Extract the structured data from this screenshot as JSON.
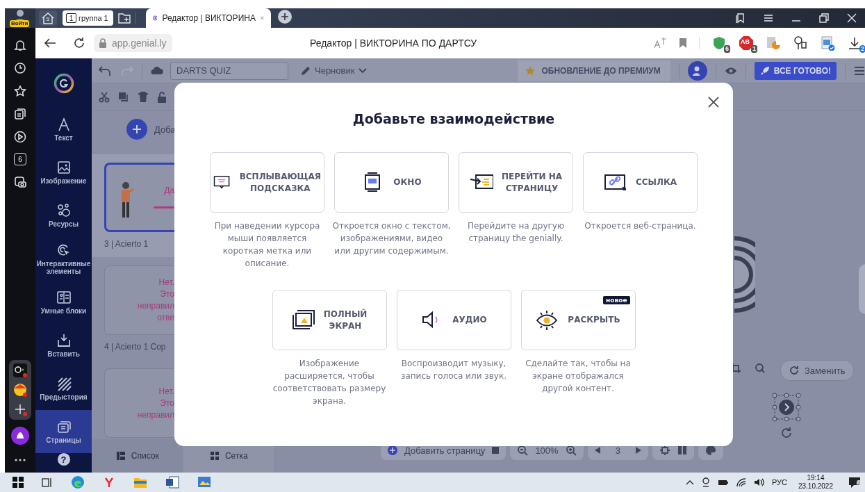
{
  "browser": {
    "profile_label": "Войти",
    "home_count": "5",
    "tab_group": {
      "number": "1",
      "name": "группа 1"
    },
    "tabs": [
      {
        "title": "Редактор | ВИКТОРИНА",
        "selected": true
      }
    ],
    "url": "app.genial.ly",
    "page_title": "Редактор | ВИКТОРИНА ПО ДАРТСУ",
    "extensions": [
      {
        "kind": "shield",
        "badge": "6"
      },
      {
        "kind": "adblock",
        "label": "AB",
        "badge": "1"
      },
      {
        "kind": "pacman"
      },
      {
        "kind": "keys"
      },
      {
        "kind": "image"
      },
      {
        "kind": "download",
        "badge": "2"
      }
    ]
  },
  "side_panel": {
    "calendar_day": "6"
  },
  "app_sidebar": {
    "items": [
      {
        "kind": "text",
        "label": "Текст",
        "selected": false
      },
      {
        "kind": "image",
        "label": "Изображение",
        "selected": false
      },
      {
        "kind": "resources",
        "label": "Ресурсы",
        "selected": false
      },
      {
        "kind": "interactive",
        "label": "Интерактивные элементы",
        "selected": false
      },
      {
        "kind": "smart",
        "label": "Умные блоки",
        "selected": false
      },
      {
        "kind": "insert",
        "label": "Вставить",
        "selected": false
      },
      {
        "kind": "background",
        "label": "Предыстория",
        "selected": false
      },
      {
        "kind": "pages",
        "label": "Страницы",
        "selected": true
      }
    ],
    "help": "?"
  },
  "toolbar": {
    "title_field": "DARTS QUIZ",
    "status": "Черновик",
    "upgrade": "ОБНОВЛЕНИЕ ДО ПРЕМИУМ",
    "publish": "ВСЕ ГОТОВО!"
  },
  "pages_panel": {
    "add_label": "Доба",
    "pages": [
      {
        "selected": true,
        "thumbnail_lines": [
          "Да"
        ],
        "caption": "3 | Acierto 1"
      },
      {
        "selected": false,
        "thumbnail_lines": [
          "Нет.",
          "Это",
          "неправил",
          "отве"
        ],
        "caption": "4 | Acierto 1 Cop"
      },
      {
        "selected": false,
        "thumbnail_lines": [
          "Нет.",
          "Это",
          "неправил"
        ]
      }
    ],
    "view_tabs": [
      {
        "label": "Список",
        "selected": true
      },
      {
        "label": "Сетка",
        "selected": false
      }
    ]
  },
  "canvas": {
    "replace_button": "Заменить"
  },
  "bottom_bar": {
    "add_page": "Добавить страницу",
    "zoom": "100%",
    "page": "3"
  },
  "modal": {
    "title": "Добавьте взаимодействие",
    "option_rows": [
      [
        {
          "kind": "tooltip",
          "label": "ВСПЛЫВАЮЩАЯ\nПОДСКАЗКА",
          "description": "При наведении курсора мыши появляется короткая метка или описание."
        },
        {
          "kind": "window",
          "label": "ОКНО",
          "description": "Откроется окно с текстом, изображениями, видео или другим содержимым."
        },
        {
          "kind": "goto",
          "label": "ПЕРЕЙТИ НА\nСТРАНИЦУ",
          "description": "Перейдите на другую страницу the genially."
        },
        {
          "kind": "link",
          "label": "ССЫЛКА",
          "description": "Откроется веб-страница."
        }
      ],
      [
        {
          "kind": "fullscreen",
          "label": "ПОЛНЫЙ\nЭКРАН",
          "description": "Изображение расширяется, чтобы соответствовать размеру экрана."
        },
        {
          "kind": "audio",
          "label": "АУДИО",
          "description": "Воспроизводит музыку, запись голоса или звук."
        },
        {
          "kind": "reveal",
          "label": "РАСКРЫТЬ",
          "badge": "новое",
          "description": "Сделайте так, чтобы на экране отображался другой контент."
        }
      ]
    ]
  },
  "taskbar": {
    "language": "РУС",
    "time": "19:14",
    "date": "23.10.2022",
    "notifications": "2"
  }
}
